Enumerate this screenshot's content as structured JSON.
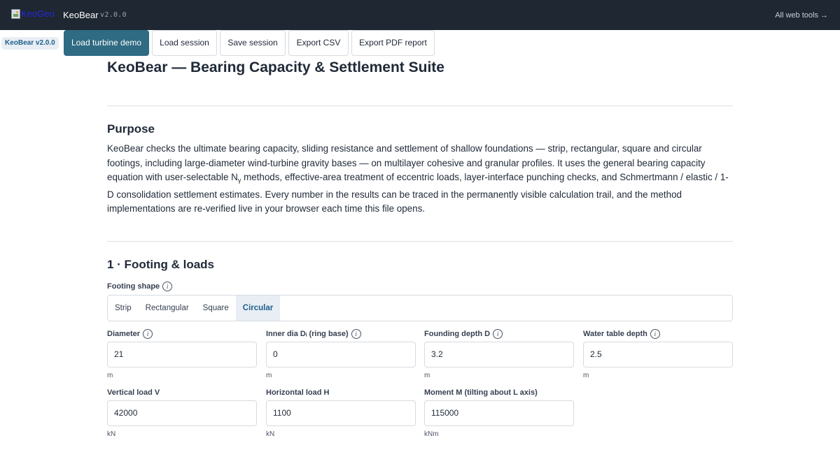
{
  "topbar": {
    "logo_alt": "KeoGeo",
    "app_name": "KeoBear",
    "version": "v2.0.0",
    "all_tools": "All web tools →"
  },
  "toolbar": {
    "badge": "KeoBear v2.0.0",
    "buttons": [
      "Load turbine demo",
      "Load session",
      "Save session",
      "Export CSV",
      "Export PDF report"
    ]
  },
  "page": {
    "title": "KeoBear — Bearing Capacity & Settlement Suite"
  },
  "purpose": {
    "heading": "Purpose",
    "text_1": "KeoBear checks the ultimate bearing capacity, sliding resistance and settlement of shallow foundations — strip, rectangular, square and circular footings, including large-diameter wind-turbine gravity bases — on multilayer cohesive and granular profiles. It uses the general bearing capacity equation with user-selectable N",
    "subscript": "γ",
    "text_2": " methods, effective-area treatment of eccentric loads, layer-interface punching checks, and Schmertmann / elastic / 1-D consolidation settlement estimates. Every number in the results can be traced in the permanently visible calculation trail, and the method implementations are re-verified live in your browser each time this file opens."
  },
  "footing": {
    "heading": "1 · Footing & loads",
    "shape_label": "Footing shape",
    "shapes": [
      "Strip",
      "Rectangular",
      "Square",
      "Circular"
    ],
    "selected_shape": "Circular",
    "fields": [
      {
        "label": "Diameter",
        "value": "21",
        "unit": "m",
        "info": true
      },
      {
        "label": "Inner dia Dᵢ (ring base)",
        "value": "0",
        "unit": "m",
        "info": true
      },
      {
        "label": "Founding depth D",
        "value": "3.2",
        "unit": "m",
        "info": true
      },
      {
        "label": "Water table depth",
        "value": "2.5",
        "unit": "m",
        "info": true
      },
      {
        "label": "Vertical load V",
        "value": "42000",
        "unit": "kN",
        "info": false
      },
      {
        "label": "Horizontal load H",
        "value": "1100",
        "unit": "kN",
        "info": false
      },
      {
        "label": "Moment M (tilting about L axis)",
        "value": "115000",
        "unit": "kNm",
        "info": false
      }
    ]
  },
  "icons": {
    "info": "info-icon",
    "logo": "broken-image-icon"
  },
  "colors": {
    "topbar": "#1e2732",
    "primary": "#2f6b83",
    "accent": "#1f5f8b"
  }
}
